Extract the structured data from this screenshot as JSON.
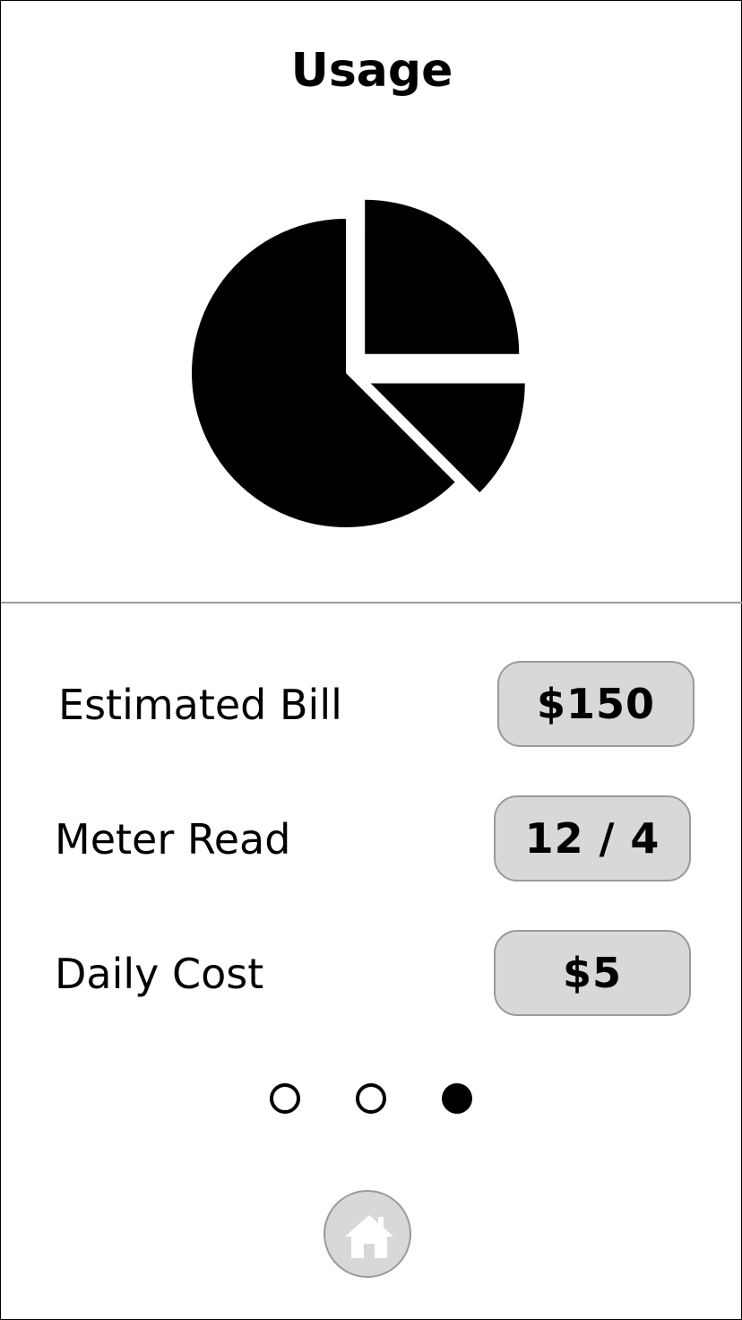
{
  "header": {
    "title": "Usage"
  },
  "chart_data": {
    "type": "pie",
    "slices": [
      {
        "value": 25
      },
      {
        "value": 12.5
      },
      {
        "value": 62.5
      }
    ]
  },
  "details": [
    {
      "label": "Estimated Bill",
      "value": "$150"
    },
    {
      "label": "Meter Read",
      "value": "12 / 4"
    },
    {
      "label": "Daily Cost",
      "value": "$5"
    }
  ],
  "pager": {
    "pages": 3,
    "active_index": 2
  },
  "nav": {
    "home_icon": "home-icon"
  },
  "colors": {
    "slice": "#000000",
    "pill_bg": "#d8d8d8",
    "divider": "#9a9a9a",
    "home_icon": "#ffffff"
  }
}
